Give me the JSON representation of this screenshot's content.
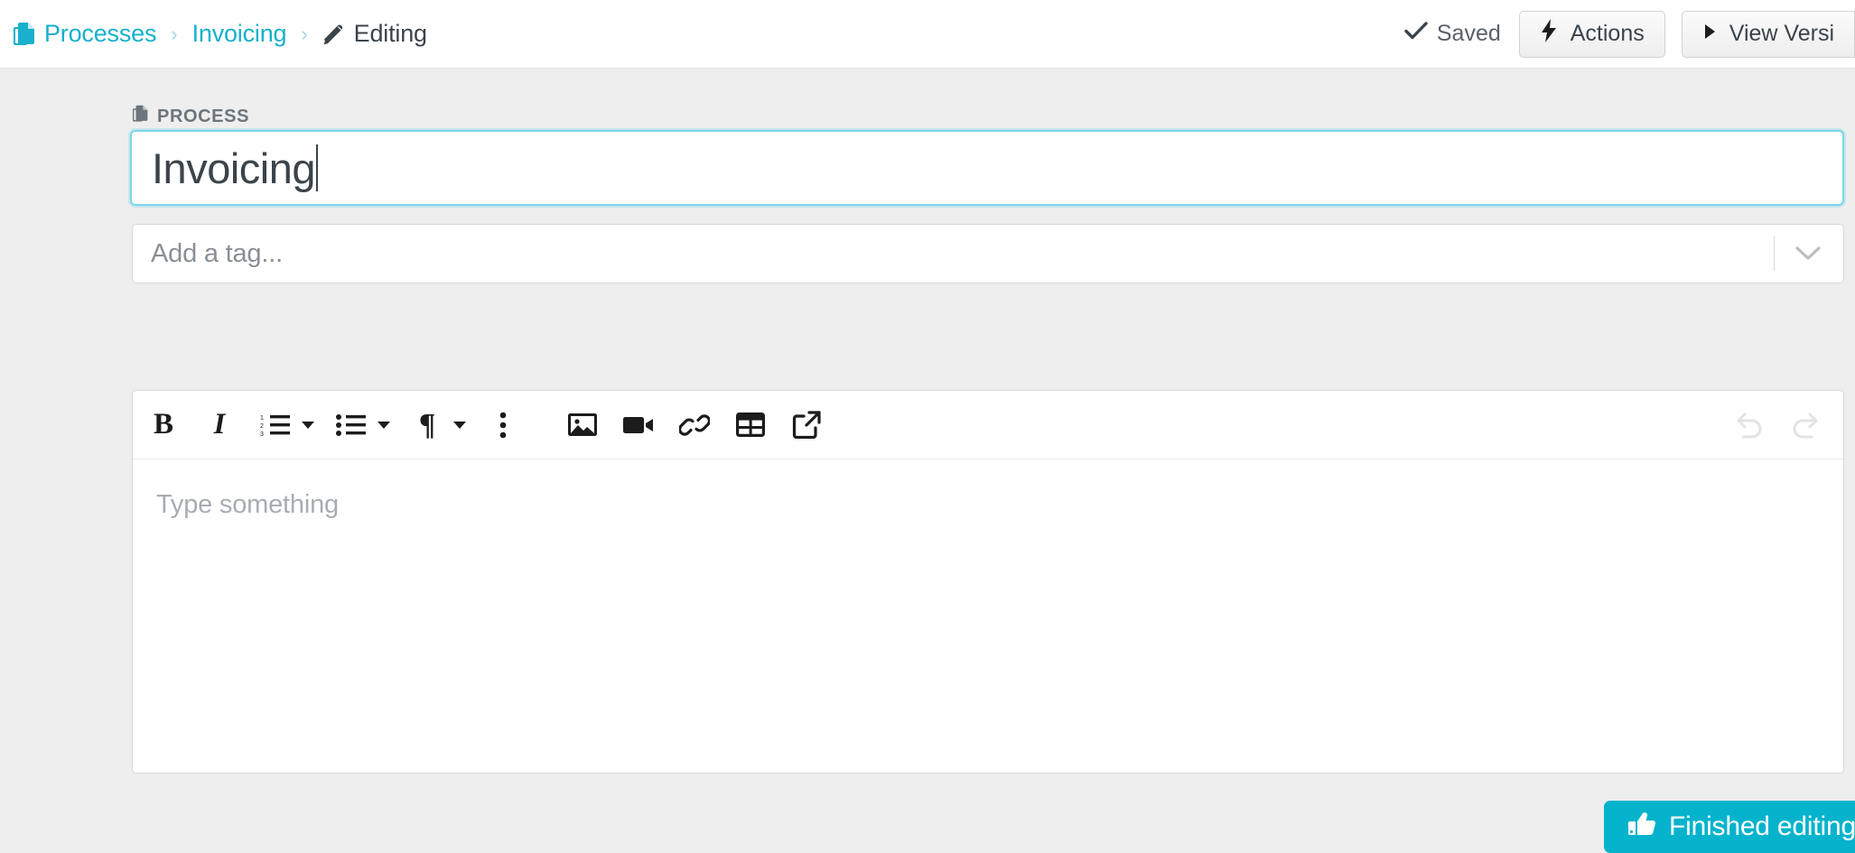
{
  "topbar": {
    "breadcrumb": {
      "root_icon": "documents-icon",
      "items": [
        {
          "label": "Processes",
          "type": "link"
        },
        {
          "label": "Invoicing",
          "type": "link"
        },
        {
          "label": "Editing",
          "type": "current",
          "icon": "pencil-icon"
        }
      ],
      "separator": "›"
    },
    "saved_label": "Saved",
    "saved_icon": "check-icon",
    "actions_label": "Actions",
    "actions_icon": "lightning-bolt-icon",
    "view_versions_label": "View Versi",
    "view_versions_icon": "play-triangle-icon"
  },
  "form": {
    "process_label": "PROCESS",
    "process_label_icon": "documents-icon",
    "title_value": "Invoicing",
    "title_focused": true,
    "tag_placeholder": "Add a tag...",
    "tag_value": "",
    "tag_chevron_icon": "chevron-down-icon"
  },
  "editor": {
    "placeholder": "Type something",
    "content": "",
    "toolbar_left": [
      {
        "name": "bold-icon",
        "label": "B",
        "has_caret": false
      },
      {
        "name": "italic-icon",
        "label": "I",
        "has_caret": false
      },
      {
        "name": "ordered-list-icon",
        "label": "",
        "has_caret": true
      },
      {
        "name": "unordered-list-icon",
        "label": "",
        "has_caret": true
      },
      {
        "name": "paragraph-icon",
        "label": "¶",
        "has_caret": true
      },
      {
        "name": "more-options-icon",
        "label": "",
        "has_caret": false
      },
      {
        "name": "image-icon",
        "label": "",
        "has_caret": false
      },
      {
        "name": "video-icon",
        "label": "",
        "has_caret": false
      },
      {
        "name": "link-icon",
        "label": "",
        "has_caret": false
      },
      {
        "name": "table-icon",
        "label": "",
        "has_caret": false
      },
      {
        "name": "embed-icon",
        "label": "",
        "has_caret": false
      }
    ],
    "toolbar_right": [
      {
        "name": "undo-icon",
        "disabled": true
      },
      {
        "name": "redo-icon",
        "disabled": true
      }
    ]
  },
  "footer": {
    "finish_label": "Finished editing",
    "finish_icon": "thumbs-up-icon"
  },
  "colors": {
    "accent_teal": "#18b0cc",
    "button_teal": "#05b3cd",
    "focus_border": "#7ad7e8",
    "page_background": "#eeeeee",
    "topbar_background": "#ffffff",
    "text_dark": "#3b444b",
    "text_muted": "#8a8f94"
  }
}
